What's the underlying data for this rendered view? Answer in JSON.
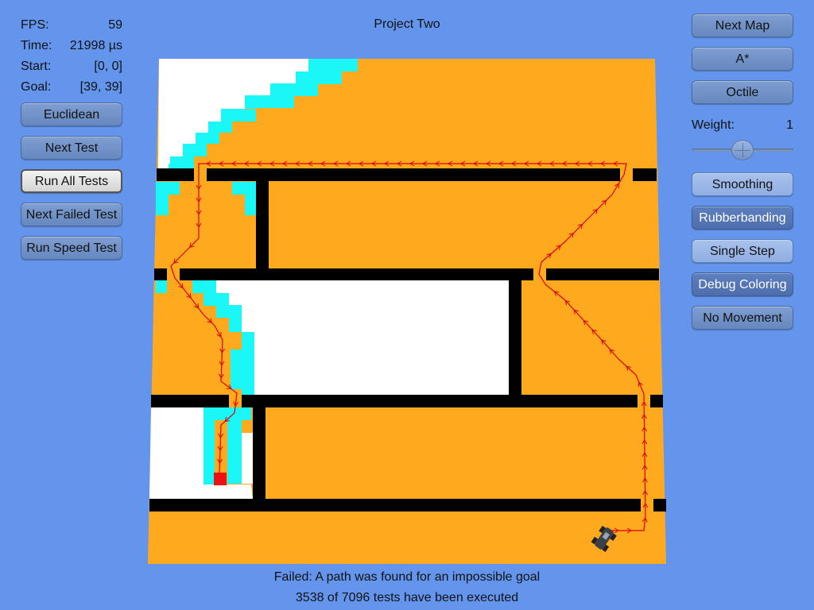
{
  "title": "Project Two",
  "stats": [
    {
      "label": "FPS:",
      "value": "59"
    },
    {
      "label": "Time:",
      "value": "21998 µs"
    },
    {
      "label": "Start:",
      "value": "[0, 0]"
    },
    {
      "label": "Goal:",
      "value": "[39, 39]"
    }
  ],
  "left_buttons": [
    "Euclidean",
    "Next Test",
    "Run All Tests",
    "Next Failed Test",
    "Run Speed Test"
  ],
  "right_buttons": {
    "next_map": "Next Map",
    "algorithm": "A*",
    "heuristic": "Octile",
    "smoothing": "Smoothing",
    "rubberbanding": "Rubberbanding",
    "single_step": "Single Step",
    "debug_coloring": "Debug Coloring",
    "no_movement": "No Movement"
  },
  "weight": {
    "label": "Weight:",
    "value": "1",
    "level": 0.5
  },
  "status": {
    "message": "Failed: A path was found for an impossible goal",
    "progress": "3538 of 7096 tests have been executed"
  },
  "colors": {
    "background": "#6495ED",
    "open": "#FFA91F",
    "closed": "#FFFFFF",
    "frontier": "#1BF6F6",
    "wall": "#000000",
    "path": "#DD0000",
    "goal": "#EE1111"
  }
}
